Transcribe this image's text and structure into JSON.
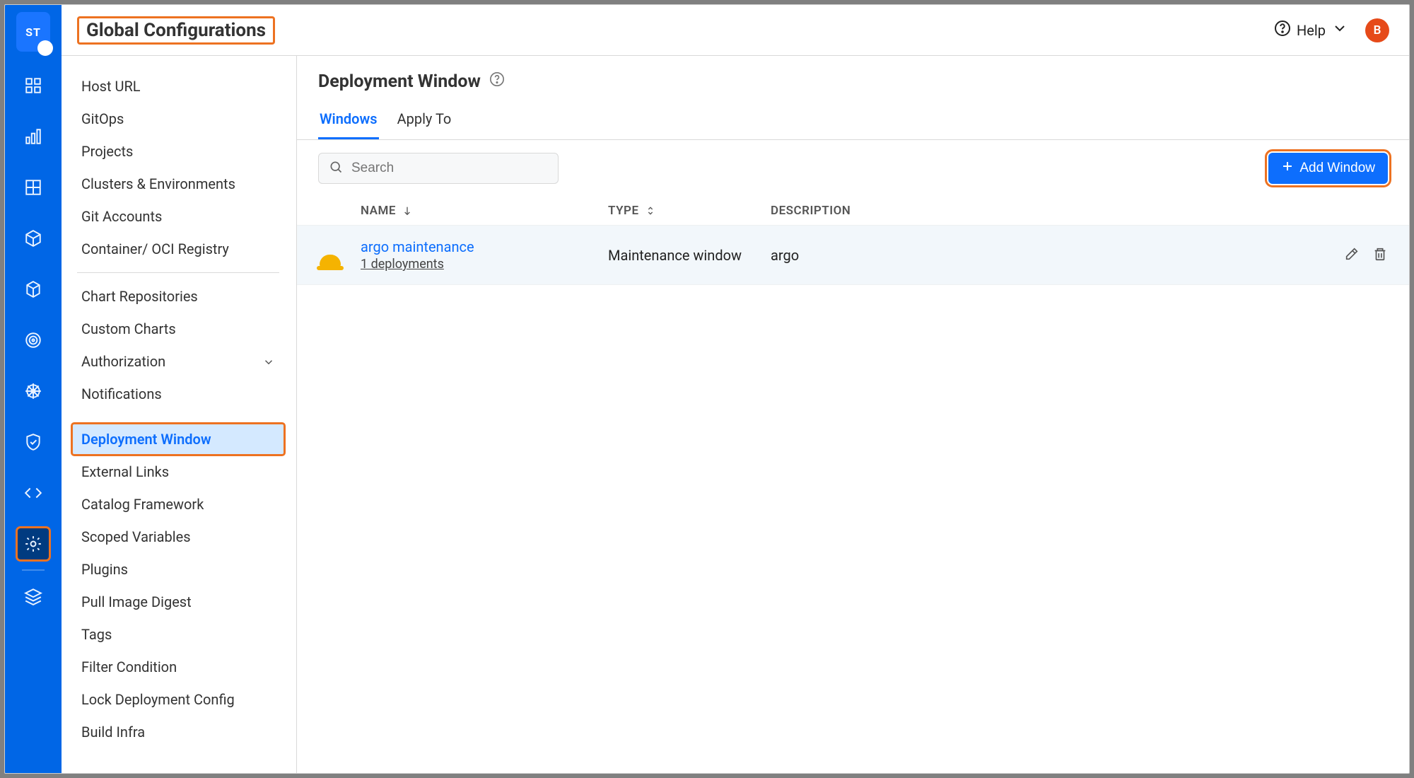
{
  "topbar": {
    "title": "Global Configurations",
    "help_label": "Help",
    "avatar_initial": "B"
  },
  "rail": {
    "logo_text": "ST",
    "items": [
      {
        "id": "dashboard",
        "name": "dashboard-grid-icon",
        "active": false
      },
      {
        "id": "apps",
        "name": "apps-bar-icon",
        "active": false
      },
      {
        "id": "jobs",
        "name": "jobs-grid-icon",
        "active": false
      },
      {
        "id": "charts",
        "name": "charts-box-icon",
        "active": false
      },
      {
        "id": "cube",
        "name": "cube-icon",
        "active": false
      },
      {
        "id": "target",
        "name": "target-icon",
        "active": false
      },
      {
        "id": "ship",
        "name": "ship-wheel-icon",
        "active": false
      },
      {
        "id": "security",
        "name": "shield-check-icon",
        "active": false
      },
      {
        "id": "code",
        "name": "code-icon",
        "active": false
      },
      {
        "id": "settings",
        "name": "settings-gear-icon",
        "active": true,
        "highlight": true
      },
      {
        "id": "stack",
        "name": "stack-icon",
        "active": false
      }
    ]
  },
  "settings_nav": {
    "groups": [
      [
        {
          "label": "Host URL"
        },
        {
          "label": "GitOps"
        },
        {
          "label": "Projects"
        },
        {
          "label": "Clusters & Environments"
        },
        {
          "label": "Git Accounts"
        },
        {
          "label": "Container/ OCI Registry"
        }
      ],
      [
        {
          "label": "Chart Repositories"
        },
        {
          "label": "Custom Charts"
        },
        {
          "label": "Authorization",
          "expandable": true
        },
        {
          "label": "Notifications"
        }
      ],
      [
        {
          "label": "Deployment Window",
          "selected": true,
          "highlighted": true
        },
        {
          "label": "External Links"
        },
        {
          "label": "Catalog Framework"
        },
        {
          "label": "Scoped Variables"
        },
        {
          "label": "Plugins"
        },
        {
          "label": "Pull Image Digest"
        },
        {
          "label": "Tags"
        },
        {
          "label": "Filter Condition"
        },
        {
          "label": "Lock Deployment Config"
        },
        {
          "label": "Build Infra"
        }
      ]
    ]
  },
  "main": {
    "page_title": "Deployment Window",
    "tabs": [
      {
        "label": "Windows",
        "active": true
      },
      {
        "label": "Apply To",
        "active": false
      }
    ],
    "search_placeholder": "Search",
    "add_button_label": "Add Window",
    "columns": {
      "name": "Name",
      "type": "Type",
      "description": "Description"
    },
    "rows": [
      {
        "name": "argo maintenance",
        "deployments_label": "1 deployments",
        "type": "Maintenance window",
        "description": "argo"
      }
    ]
  }
}
